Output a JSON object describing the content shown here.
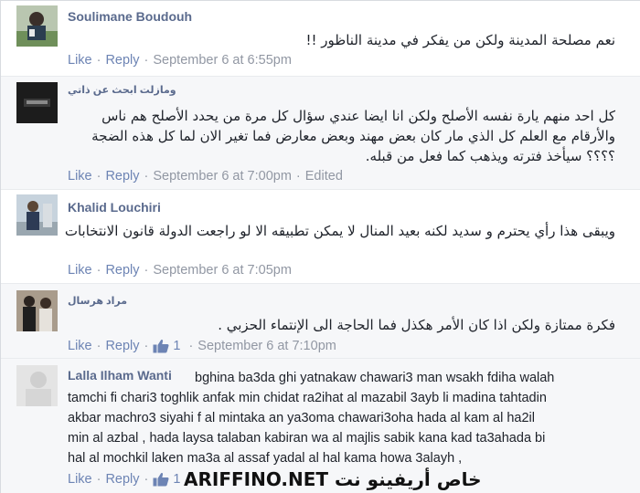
{
  "comments": [
    {
      "author": "Soulimane Boudouh",
      "text": "نعم مصلحة المدينة ولكن من يفكر في مدينة الناظور !!",
      "like_label": "Like",
      "reply_label": "Reply",
      "time": "September 6 at 6:55pm"
    },
    {
      "author": "ومازلت ابحث عن ذاتي",
      "text": "كل احد منهم يارة نفسه الأصلح ولكن انا ايضا عندي سؤال كل مرة من يحدد الأصلح هم ناس والأرقام مع العلم كل الذي مار كان بعض مهند وبعض معارض فما تغير الان لما كل هذه الضجة ؟؟؟؟ سيأخذ فترته ويذهب كما فعل من قبله.",
      "like_label": "Like",
      "reply_label": "Reply",
      "time": "September 6 at 7:00pm",
      "edited": "Edited"
    },
    {
      "author": "Khalid Louchiri",
      "text": "ويبقى هذا رأي يحترم و سديد لكنه بعيد المنال لا يمكن تطبيقه الا لو راجعت الدولة قانون الانتخابات",
      "like_label": "Like",
      "reply_label": "Reply",
      "time": "September 6 at 7:05pm"
    },
    {
      "author": "مراد هرسال",
      "text": "فكرة ممتازة ولكن اذا كان الأمر هكذل فما الحاجة الى الإنتماء الحزبي .",
      "like_label": "Like",
      "reply_label": "Reply",
      "likes": "1",
      "time": "September 6 at 7:10pm"
    },
    {
      "author": "Lalla Ilham Wanti",
      "text_lines": [
        "bghina ba3da ghi yatnakaw chawari3 man wsakh fdiha walah",
        "tamchi fi chari3 toghlik anfak min chidat ra2ihat al mazabil 3ayb li madina tahtadin",
        "akbar machro3 siyahi f al mintaka an ya3oma chawari3oha hada al kam al ha2il",
        "min al azbal , hada laysa talaban kabiran wa al majlis sabik kana kad ta3ahada bi",
        "hal al mochkil laken ma3a al assaf yadal al hal kama howa 3alayh ,"
      ],
      "like_label": "Like",
      "reply_label": "Reply",
      "likes": "1"
    }
  ],
  "watermark": "ARIFFINO.NET خاص أريفينو نت",
  "icons": {
    "like": "thumbs-up-icon"
  },
  "colors": {
    "link": "#6d84b4",
    "author": "#5a6a8d",
    "meta": "#9197a3"
  }
}
